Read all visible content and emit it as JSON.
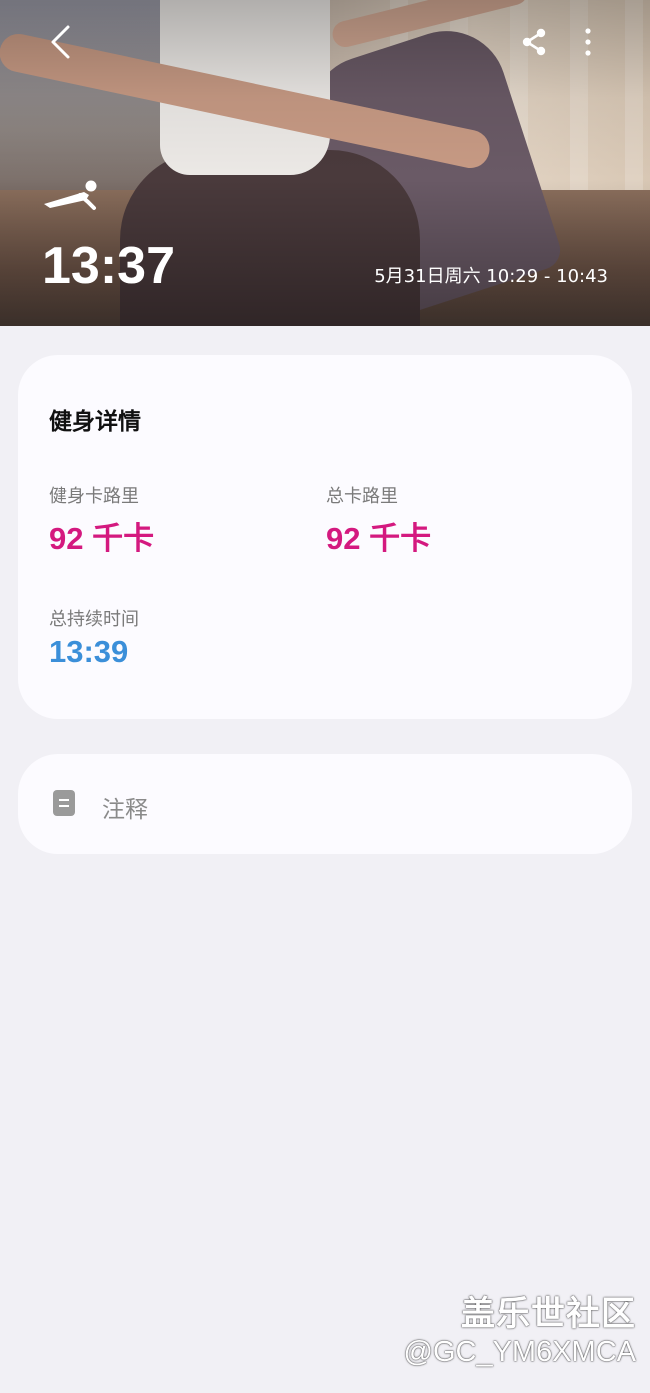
{
  "hero": {
    "duration": "13:37",
    "date_range": "5月31日周六 10:29 - 10:43",
    "workout_icon": "pushup-icon",
    "nav": {
      "back_icon": "back-icon",
      "share_icon": "share-icon",
      "more_icon": "more-vertical-icon"
    }
  },
  "details": {
    "title": "健身详情",
    "fitness_calories_label": "健身卡路里",
    "fitness_calories_value": "92 千卡",
    "total_calories_label": "总卡路里",
    "total_calories_value": "92 千卡",
    "total_duration_label": "总持续时间",
    "total_duration_value": "13:39",
    "colors": {
      "calories": "#d4197f",
      "duration": "#3b8fd9"
    }
  },
  "notes": {
    "icon": "note-icon",
    "label": "注释"
  },
  "watermark": {
    "title": "盖乐世社区",
    "handle": "@GC_YM6XMCA"
  }
}
